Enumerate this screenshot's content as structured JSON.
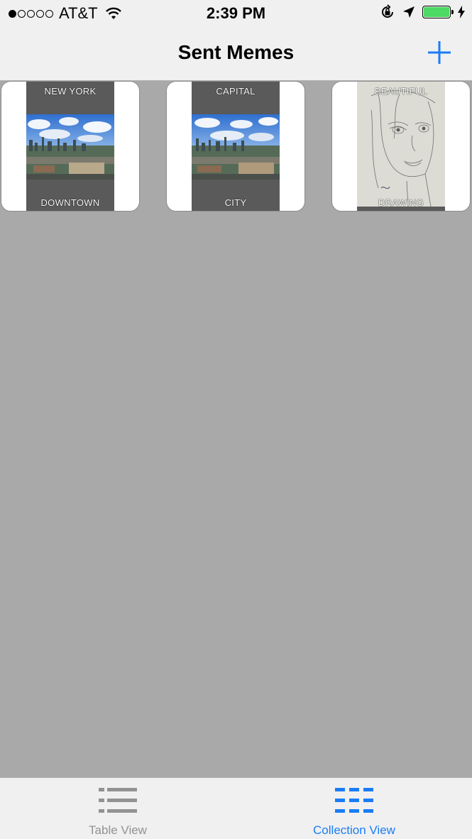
{
  "status_bar": {
    "carrier": "AT&T",
    "time": "2:39 PM",
    "signal_bars_filled": 1,
    "signal_bars_total": 5
  },
  "navbar": {
    "title": "Sent Memes",
    "add_icon": "plus-icon"
  },
  "memes": [
    {
      "top_text": "NEW YORK",
      "bottom_text": "DOWNTOWN",
      "image": "city-skyline-photo"
    },
    {
      "top_text": "CAPITAL",
      "bottom_text": "CITY",
      "image": "city-skyline-photo"
    },
    {
      "top_text": "BEAUTIFUL",
      "bottom_text": "DRAWING",
      "image": "pencil-sketch-portrait"
    }
  ],
  "tabs": [
    {
      "label": "Table View",
      "icon": "list-icon",
      "selected": false
    },
    {
      "label": "Collection View",
      "icon": "grid-icon",
      "selected": true
    }
  ],
  "colors": {
    "accent": "#1a7cf5",
    "inactive_tab": "#929292",
    "background": "#a9a9a9",
    "bar_background": "#f0f0f0",
    "battery": "#4cd964"
  }
}
